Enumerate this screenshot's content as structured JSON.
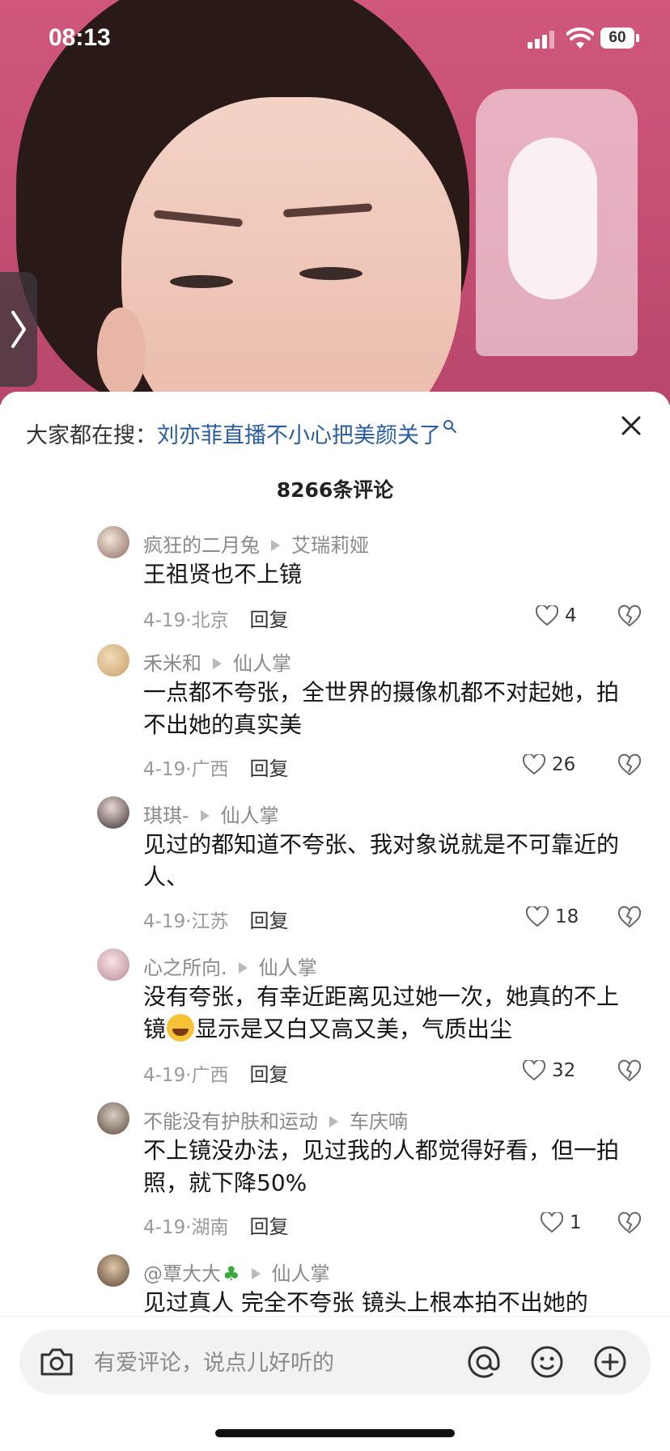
{
  "status_bar": {
    "time": "08:13",
    "battery": "60"
  },
  "search_suggest": {
    "label": "大家都在搜：",
    "term": "刘亦菲直播不小心把美颜关了"
  },
  "comments_header": {
    "count_text": "8266条评论"
  },
  "comments": [
    {
      "user": "疯狂的二月兔",
      "reply_to": "艾瑞莉娅",
      "text": "王祖贤也不上镜",
      "date": "4-19",
      "location": "北京",
      "reply": "回复",
      "likes": "4"
    },
    {
      "user": "禾米和",
      "reply_to": "仙人掌",
      "text": "一点都不夸张，全世界的摄像机都不对起她，拍不出她的真实美",
      "date": "4-19",
      "location": "广西",
      "reply": "回复",
      "likes": "26"
    },
    {
      "user": "琪琪-",
      "reply_to": "仙人掌",
      "text": "见过的都知道不夸张、我对象说就是不可靠近的人、",
      "date": "4-19",
      "location": "江苏",
      "reply": "回复",
      "likes": "18"
    },
    {
      "user": "心之所向.",
      "reply_to": "仙人掌",
      "text": "没有夸张，有幸近距离见过她一次，她真的不上镜",
      "text2": "显示是又白又高又美，气质出尘",
      "date": "4-19",
      "location": "广西",
      "reply": "回复",
      "likes": "32"
    },
    {
      "user": "不能没有护肤和运动",
      "reply_to": "车庆喃",
      "text": "不上镜没办法，见过我的人都觉得好看，但一拍照，就下降50%",
      "date": "4-19",
      "location": "湖南",
      "reply": "回复",
      "likes": "1"
    },
    {
      "user": "@覃大大",
      "reply_to": "仙人掌",
      "text": "见过真人 完全不夸张 镜头上根本拍不出她的"
    }
  ],
  "input": {
    "placeholder": "有爱评论，说点儿好听的"
  },
  "colors": {
    "link": "#2a5d9f",
    "muted": "#8a8a8a"
  }
}
